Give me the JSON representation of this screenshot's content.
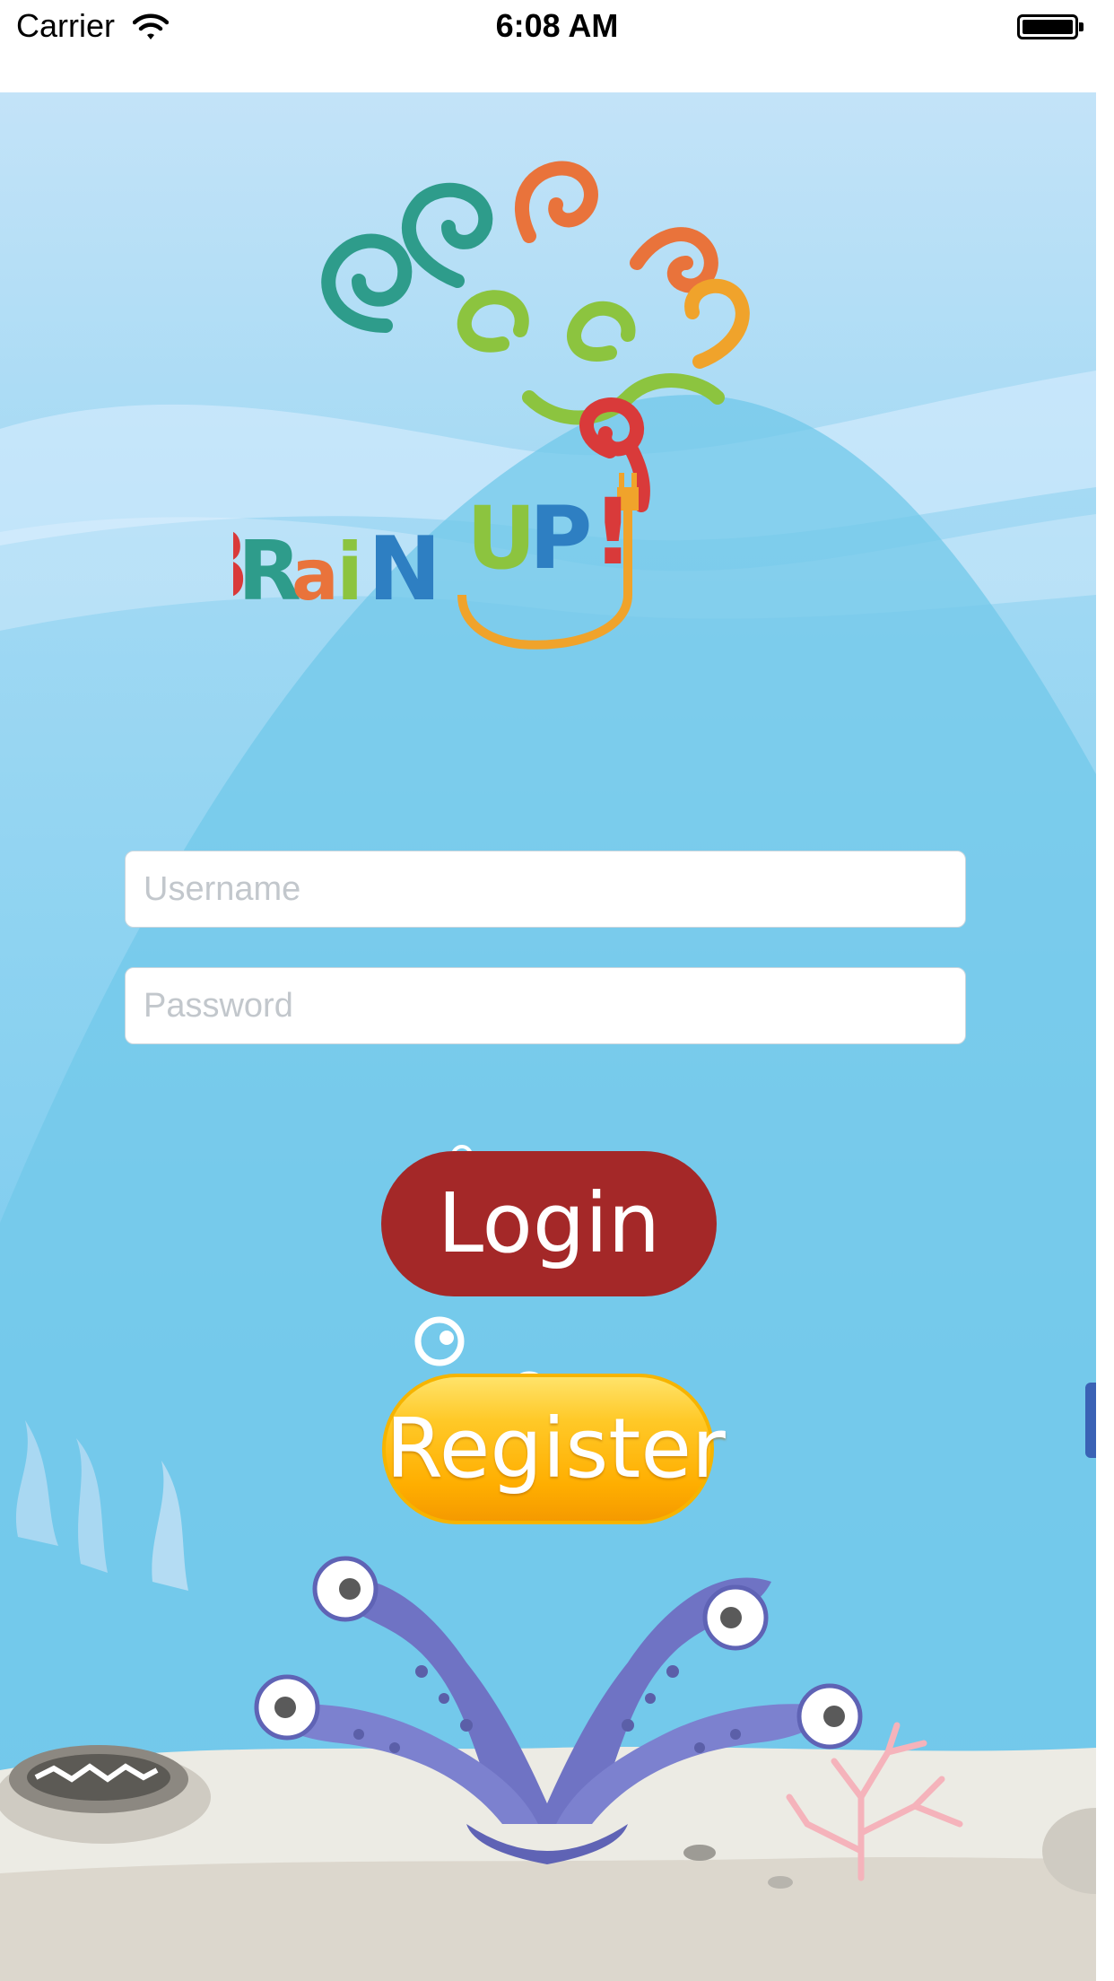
{
  "status_bar": {
    "carrier": "Carrier",
    "time": "6:08 AM",
    "wifi_icon": "wifi-icon",
    "battery_icon": "battery-icon"
  },
  "logo": {
    "text": "BRaiN UP!",
    "icon": "brain-plug-logo"
  },
  "form": {
    "username_placeholder": "Username",
    "username_value": "",
    "password_placeholder": "Password",
    "password_value": ""
  },
  "buttons": {
    "login_label": "Login",
    "register_label": "Register"
  },
  "colors": {
    "login_button": "#a42828",
    "register_button": "#ffbf1a",
    "sky": "#c3e3f8",
    "water": "#74c7ec",
    "sand": "#ecebe4",
    "coral": "#6f73c4"
  }
}
